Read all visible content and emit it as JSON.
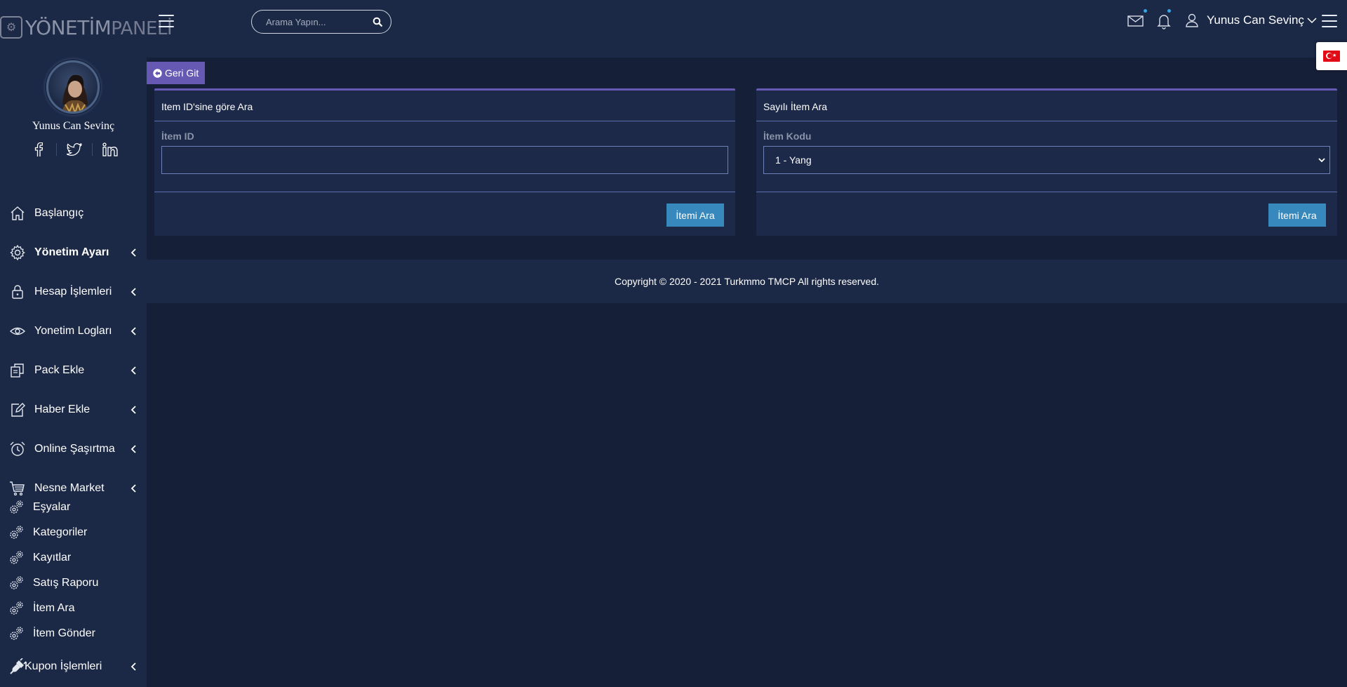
{
  "brand": {
    "logo_main": "YÖNETİM",
    "logo_thin": "PANELİ"
  },
  "header": {
    "search_placeholder": "Arama Yapın...",
    "user_name": "Yunus Can Sevinç"
  },
  "profile": {
    "name": "Yunus Can Sevinç"
  },
  "sidebar": {
    "items": [
      {
        "label": "Başlangıç",
        "icon": "home-icon",
        "has_chevron": false
      },
      {
        "label": "Yönetim Ayarı",
        "icon": "gear-icon",
        "has_chevron": true,
        "active": true
      },
      {
        "label": "Hesap İşlemleri",
        "icon": "lock-icon",
        "has_chevron": true
      },
      {
        "label": "Yonetim Logları",
        "icon": "eye-icon",
        "has_chevron": true
      },
      {
        "label": "Pack Ekle",
        "icon": "copy-icon",
        "has_chevron": true
      },
      {
        "label": "Haber Ekle",
        "icon": "edit-icon",
        "has_chevron": true
      },
      {
        "label": "Online Şaşırtma",
        "icon": "alarm-clock-icon",
        "has_chevron": true
      },
      {
        "label": "Nesne Market",
        "icon": "cart-icon",
        "has_chevron": true
      }
    ],
    "sub_items": [
      {
        "label": "Eşyalar",
        "icon": "gears-icon"
      },
      {
        "label": "Kategoriler",
        "icon": "gears-icon"
      },
      {
        "label": "Kayıtlar",
        "icon": "gears-icon"
      },
      {
        "label": "Satış Raporu",
        "icon": "gears-icon"
      },
      {
        "label": "İtem Ara",
        "icon": "gears-icon"
      },
      {
        "label": "İtem Gönder",
        "icon": "gears-icon"
      }
    ],
    "last_item": {
      "label": "Kupon İşlemleri",
      "icon": "plug-icon",
      "has_chevron": true
    }
  },
  "main": {
    "back_label": "Geri Git",
    "card_id": {
      "title": "Item ID'sine göre Ara",
      "field_label": "İtem ID",
      "field_value": "",
      "button_label": "İtemi Ara"
    },
    "card_code": {
      "title": "Sayılı İtem Ara",
      "field_label": "İtem Kodu",
      "select_value": "1 - Yang",
      "button_label": "İtemi Ara"
    }
  },
  "footer": {
    "text": "Copyright © 2020 - 2021 Turkmmo TMCP All rights reserved."
  },
  "colors": {
    "background": "#161f38",
    "panel": "#1b2846",
    "accent": "#6559b3",
    "button": "#3789bd",
    "notification_dot": "#3aa3e3"
  }
}
